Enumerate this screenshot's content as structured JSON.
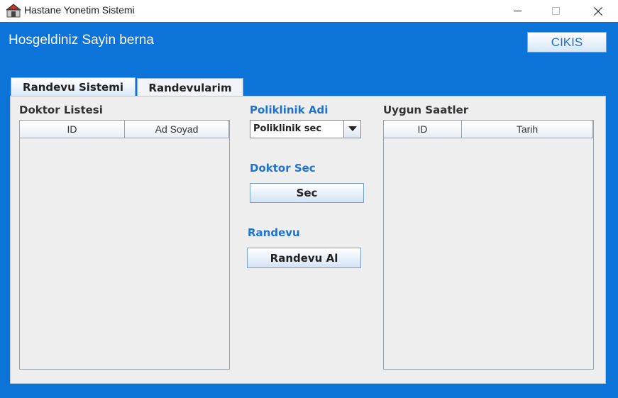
{
  "window": {
    "title": "Hastane Yonetim Sistemi",
    "controls": [
      "minimize",
      "maximize",
      "close"
    ]
  },
  "header": {
    "welcome_text": "Hosgeldiniz Sayin berna",
    "exit_label": "CIKIS"
  },
  "tabs": [
    {
      "label": "Randevu Sistemi",
      "active": true
    },
    {
      "label": "Randevularim",
      "active": false
    }
  ],
  "doctor_list": {
    "title": "Doktor Listesi",
    "columns": [
      "ID",
      "Ad Soyad"
    ],
    "rows": []
  },
  "clinic": {
    "label": "Poliklinik Adi",
    "selected": "Poliklinik sec"
  },
  "doctor_select": {
    "label": "Doktor Sec",
    "button_label": "Sec"
  },
  "appointment": {
    "label": "Randevu",
    "button_label": "Randevu Al"
  },
  "available_hours": {
    "title": "Uygun Saatler",
    "columns": [
      "ID",
      "Tarih"
    ],
    "rows": []
  },
  "colors": {
    "frame": "#0c73d9",
    "accent_label": "#1c74d0",
    "panel": "#eeeeee"
  }
}
